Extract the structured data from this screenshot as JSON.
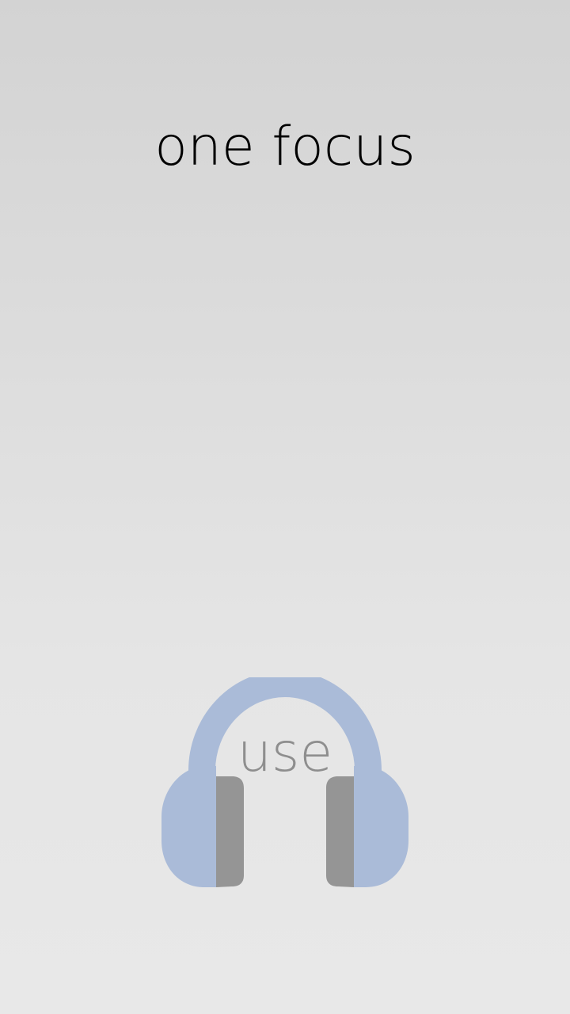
{
  "screen": {
    "title": "one focus"
  },
  "action": {
    "label": "use",
    "icon": "headphones-icon"
  },
  "colors": {
    "headphones_band": "#aabbd8",
    "ear_cushion": "#959595",
    "title_text": "#000000",
    "action_text": "#8e8e8e"
  }
}
